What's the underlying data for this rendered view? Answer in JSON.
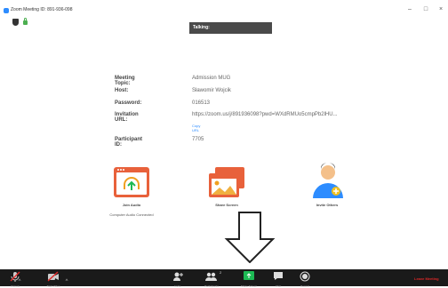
{
  "window": {
    "title": "Zoom Meeting ID: 891-936-098",
    "minimize": "–",
    "maximize": "□",
    "close": "×"
  },
  "talking": "Talking:",
  "meeting": {
    "rows": [
      {
        "label": "Meeting Topic:",
        "value": "Admission MUG"
      },
      {
        "label": "Host:",
        "value": "Sławomir Wojcik"
      },
      {
        "label": "Password:",
        "value": "016513"
      },
      {
        "label": "Invitation URL:",
        "value": "https://zoom.us/j/891936098?pwd=WXdRMUo5cmpPb2lHU..."
      },
      {
        "label": "Participant ID:",
        "value": "7705"
      }
    ],
    "copy_url": "Copy URL"
  },
  "tiles": {
    "join_audio": "Join Audio",
    "join_audio_sub": "Computer Audio Connected",
    "share_screen": "Share Screen",
    "invite_others": "Invite Others"
  },
  "bottombar": {
    "unmute": "Unmute",
    "start_video": "Start Video",
    "invite": "Invite",
    "participants": "Participants",
    "participants_count": "2",
    "share_screen": "Share Screen",
    "chat": "Chat",
    "record": "Record",
    "leave": "Leave Meeting"
  },
  "colors": {
    "accent": "#2d8cff",
    "share_green": "#1db954",
    "leave_red": "#e02828",
    "tile_orange": "#e8613b"
  }
}
